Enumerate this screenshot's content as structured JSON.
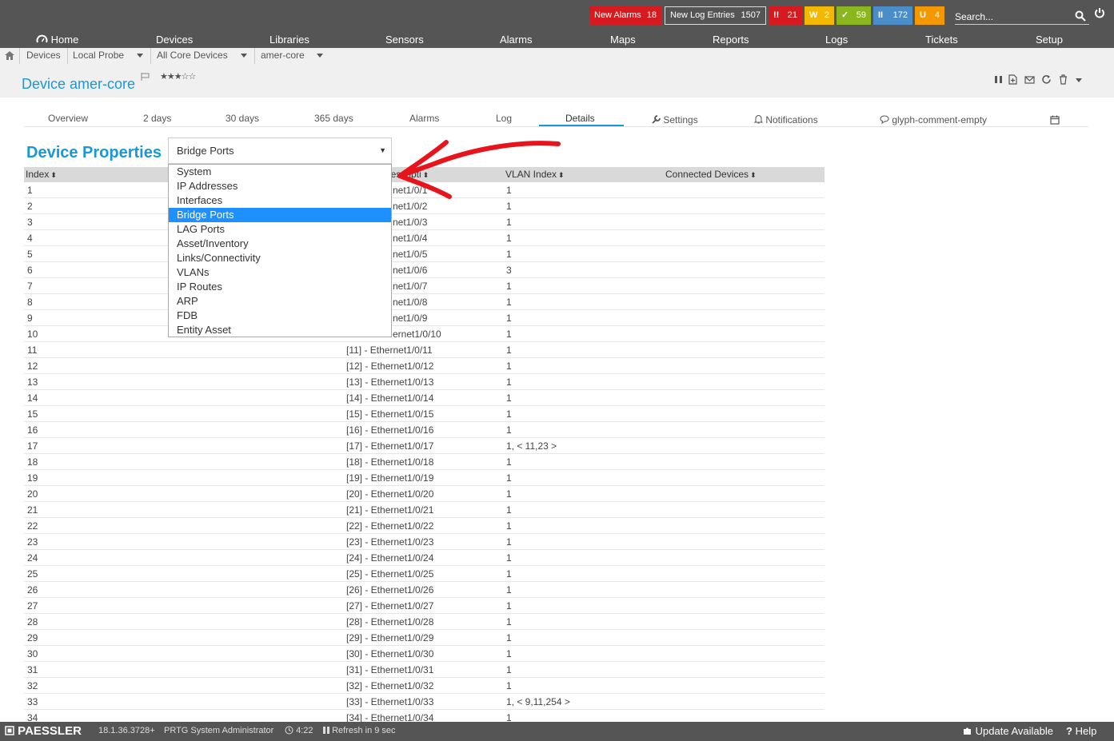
{
  "topbar": {
    "new_alarms_label": "New Alarms",
    "new_alarms_count": "18",
    "new_log_label": "New Log Entries",
    "new_log_count": "1507",
    "status_red": {
      "glyph": "!!",
      "count": "21"
    },
    "status_yellow": {
      "glyph": "W",
      "count": "2"
    },
    "status_green": {
      "glyph": "✓",
      "count": "59"
    },
    "status_blue": {
      "glyph": "II",
      "count": "172"
    },
    "status_orange": {
      "glyph": "U",
      "count": "4"
    },
    "search_placeholder": "Search..."
  },
  "nav": {
    "home": "Home",
    "devices": "Devices",
    "libraries": "Libraries",
    "sensors": "Sensors",
    "alarms": "Alarms",
    "maps": "Maps",
    "reports": "Reports",
    "logs": "Logs",
    "tickets": "Tickets",
    "setup": "Setup"
  },
  "breadcrumb": {
    "devices": "Devices",
    "probe": "Local Probe",
    "group": "All Core Devices",
    "device": "amer-core"
  },
  "device": {
    "title": "Device amer-core",
    "stars": "★★★☆☆"
  },
  "tabs": {
    "overview": "Overview",
    "two_days": "2 days",
    "thirty_days": "30 days",
    "year": "365 days",
    "alarms": "Alarms",
    "log": "Log",
    "details": "Details",
    "settings": "Settings",
    "notifications": "Notifications",
    "comments": "glyph-comment-empty"
  },
  "properties": {
    "heading": "Device Properties",
    "selected": "Bridge Ports",
    "options": [
      "System",
      "IP Addresses",
      "Interfaces",
      "Bridge Ports",
      "LAG Ports",
      "Asset/Inventory",
      "Links/Connectivity",
      "VLANs",
      "IP Routes",
      "ARP",
      "FDB",
      "Entity Asset"
    ]
  },
  "table": {
    "headers": {
      "index": "Index",
      "description": "Descripti",
      "vlan": "VLAN Index",
      "connected": "Connected Devices"
    },
    "rows": [
      {
        "index": "1",
        "desc": "net1/0/1",
        "vlan": "1"
      },
      {
        "index": "2",
        "desc": "net1/0/2",
        "vlan": "1"
      },
      {
        "index": "3",
        "desc": "net1/0/3",
        "vlan": "1"
      },
      {
        "index": "4",
        "desc": "net1/0/4",
        "vlan": "1"
      },
      {
        "index": "5",
        "desc": "net1/0/5",
        "vlan": "1"
      },
      {
        "index": "6",
        "desc": "net1/0/6",
        "vlan": "3"
      },
      {
        "index": "7",
        "desc": "net1/0/7",
        "vlan": "1"
      },
      {
        "index": "8",
        "desc": "net1/0/8",
        "vlan": "1"
      },
      {
        "index": "9",
        "desc": "net1/0/9",
        "vlan": "1"
      },
      {
        "index": "10",
        "desc": "ernet1/0/10",
        "vlan": "1"
      },
      {
        "index": "11",
        "desc": "[11] - Ethernet1/0/11",
        "vlan": "1"
      },
      {
        "index": "12",
        "desc": "[12] - Ethernet1/0/12",
        "vlan": "1"
      },
      {
        "index": "13",
        "desc": "[13] - Ethernet1/0/13",
        "vlan": "1"
      },
      {
        "index": "14",
        "desc": "[14] - Ethernet1/0/14",
        "vlan": "1"
      },
      {
        "index": "15",
        "desc": "[15] - Ethernet1/0/15",
        "vlan": "1"
      },
      {
        "index": "16",
        "desc": "[16] - Ethernet1/0/16",
        "vlan": "1"
      },
      {
        "index": "17",
        "desc": "[17] - Ethernet1/0/17",
        "vlan": "1, < 11,23 >"
      },
      {
        "index": "18",
        "desc": "[18] - Ethernet1/0/18",
        "vlan": "1"
      },
      {
        "index": "19",
        "desc": "[19] - Ethernet1/0/19",
        "vlan": "1"
      },
      {
        "index": "20",
        "desc": "[20] - Ethernet1/0/20",
        "vlan": "1"
      },
      {
        "index": "21",
        "desc": "[21] - Ethernet1/0/21",
        "vlan": "1"
      },
      {
        "index": "22",
        "desc": "[22] - Ethernet1/0/22",
        "vlan": "1"
      },
      {
        "index": "23",
        "desc": "[23] - Ethernet1/0/23",
        "vlan": "1"
      },
      {
        "index": "24",
        "desc": "[24] - Ethernet1/0/24",
        "vlan": "1"
      },
      {
        "index": "25",
        "desc": "[25] - Ethernet1/0/25",
        "vlan": "1"
      },
      {
        "index": "26",
        "desc": "[26] - Ethernet1/0/26",
        "vlan": "1"
      },
      {
        "index": "27",
        "desc": "[27] - Ethernet1/0/27",
        "vlan": "1"
      },
      {
        "index": "28",
        "desc": "[28] - Ethernet1/0/28",
        "vlan": "1"
      },
      {
        "index": "29",
        "desc": "[29] - Ethernet1/0/29",
        "vlan": "1"
      },
      {
        "index": "30",
        "desc": "[30] - Ethernet1/0/30",
        "vlan": "1"
      },
      {
        "index": "31",
        "desc": "[31] - Ethernet1/0/31",
        "vlan": "1"
      },
      {
        "index": "32",
        "desc": "[32] - Ethernet1/0/32",
        "vlan": "1"
      },
      {
        "index": "33",
        "desc": "[33] - Ethernet1/0/33",
        "vlan": "1, < 9,11,254 >"
      },
      {
        "index": "34",
        "desc": "[34] - Ethernet1/0/34",
        "vlan": "1"
      }
    ]
  },
  "footer": {
    "logo": "PAESSLER",
    "version": "18.1.36.3728+",
    "user": "PRTG System Administrator",
    "time": "4:22",
    "refresh": "Refresh in 9 sec",
    "update": "Update Available",
    "help": "Help"
  },
  "colors": {
    "accent": "#1a98d5",
    "topbar": "#555555",
    "alarm_red": "#d71920",
    "selection": "#1e90ff",
    "annotation_arrow": "#e8141c"
  }
}
